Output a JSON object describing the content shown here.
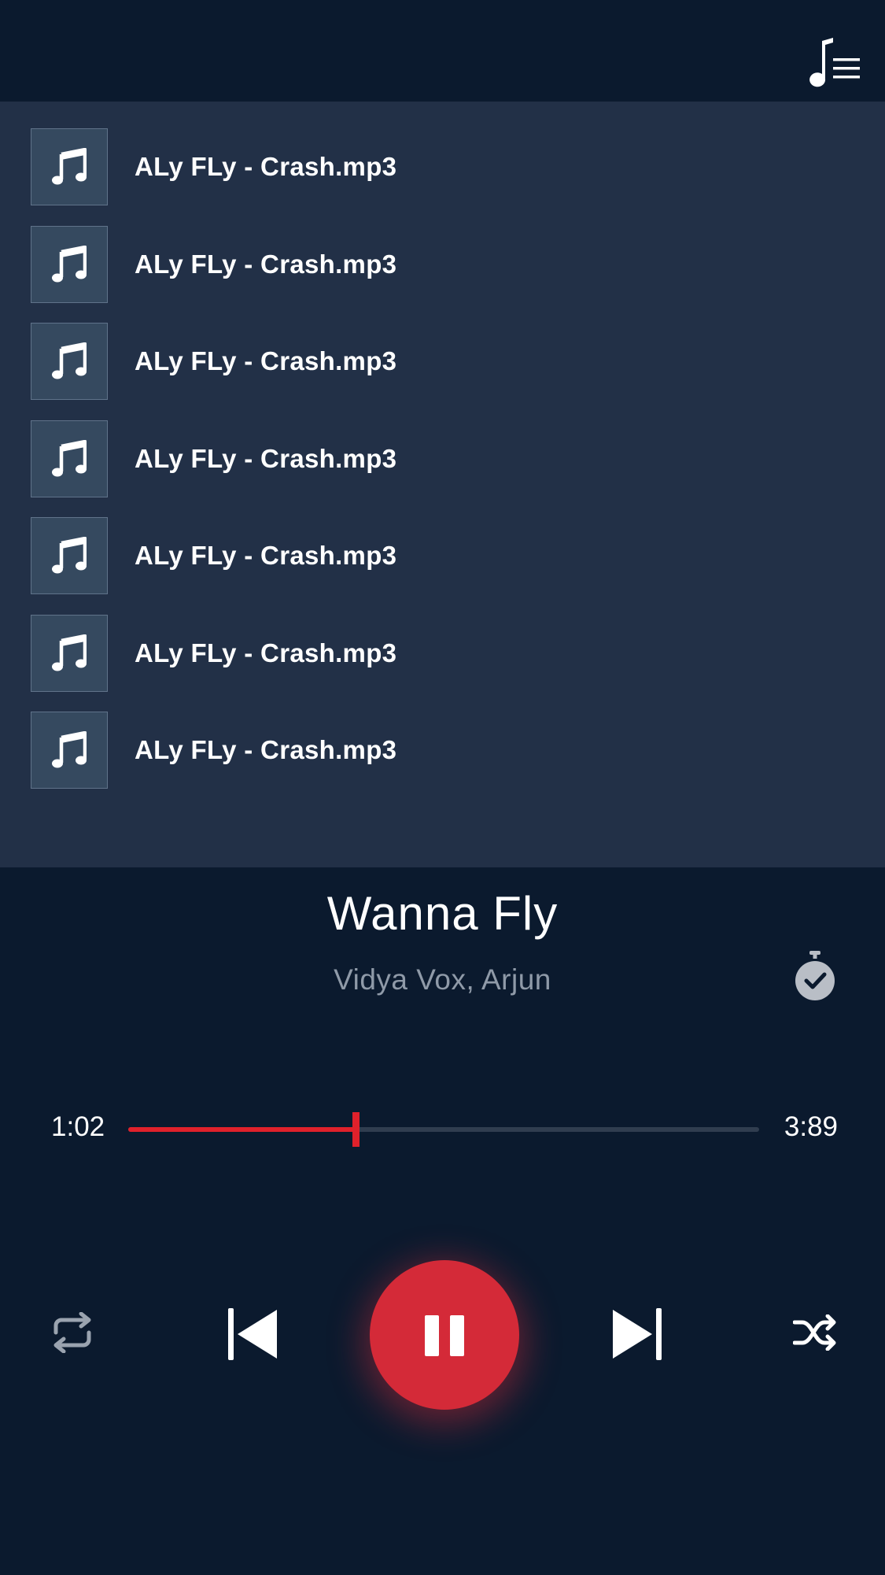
{
  "header": {
    "queue_icon": "music-queue-icon"
  },
  "playlist": {
    "items": [
      {
        "title": "ALy FLy - Crash.mp3",
        "icon": "music-note-icon"
      },
      {
        "title": "ALy FLy - Crash.mp3",
        "icon": "music-note-icon"
      },
      {
        "title": "ALy FLy - Crash.mp3",
        "icon": "music-note-icon"
      },
      {
        "title": "ALy FLy - Crash.mp3",
        "icon": "music-note-icon"
      },
      {
        "title": "ALy FLy - Crash.mp3",
        "icon": "music-note-icon"
      },
      {
        "title": "ALy FLy - Crash.mp3",
        "icon": "music-note-icon"
      },
      {
        "title": "ALy FLy - Crash.mp3",
        "icon": "music-note-icon"
      }
    ]
  },
  "now_playing": {
    "title": "Wanna Fly",
    "artist": "Vidya Vox, Arjun",
    "elapsed": "1:02",
    "total": "3:89",
    "progress": 0.36
  },
  "controls": {
    "repeat": "repeat-icon",
    "previous": "skip-previous-icon",
    "play_pause": "pause-icon",
    "next": "skip-next-icon",
    "shuffle": "shuffle-icon",
    "sleep_timer": "timer-check-icon"
  },
  "colors": {
    "background": "#0b1a2e",
    "playlist_bg": "#223047",
    "accent": "#e0212b",
    "play_button": "#d42a38",
    "muted_text": "#8f9aa8"
  }
}
